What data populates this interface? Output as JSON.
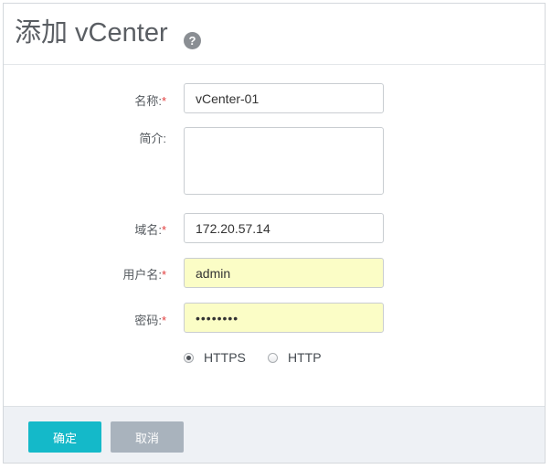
{
  "dialog": {
    "title": "添加 vCenter",
    "help_icon": "question-circle-icon"
  },
  "form": {
    "name": {
      "label": "名称:",
      "required": "*",
      "value": "vCenter-01"
    },
    "description": {
      "label": "简介:",
      "value": ""
    },
    "domain": {
      "label": "域名:",
      "required": "*",
      "value": "172.20.57.14"
    },
    "username": {
      "label": "用户名:",
      "required": "*",
      "value": "admin"
    },
    "password": {
      "label": "密码:",
      "required": "*",
      "value": "••••••••"
    },
    "protocol": {
      "options": [
        "HTTPS",
        "HTTP"
      ],
      "selected": "HTTPS"
    }
  },
  "footer": {
    "confirm_label": "确定",
    "cancel_label": "取消"
  },
  "colors": {
    "primary": "#14b9c9",
    "secondary": "#a9b3bd",
    "required": "#e23c3c",
    "autofill": "#fbfdc6"
  }
}
